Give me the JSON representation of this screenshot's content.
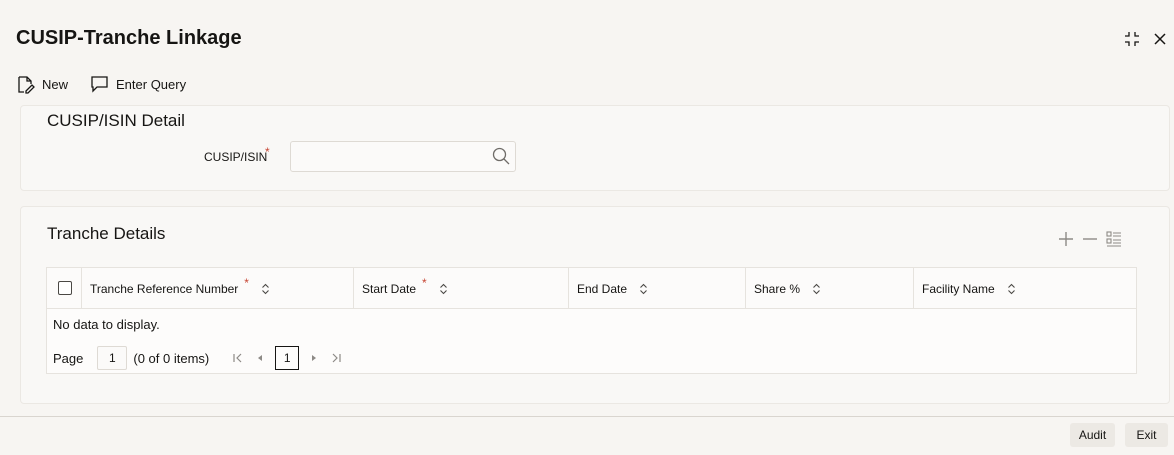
{
  "header": {
    "title": "CUSIP-Tranche Linkage"
  },
  "toolbar": {
    "new_label": "New",
    "enter_query_label": "Enter Query"
  },
  "cusip_section": {
    "title": "CUSIP/ISIN Detail",
    "field_label": "CUSIP/ISIN",
    "required_mark": "*",
    "value": "",
    "placeholder": ""
  },
  "tranche_section": {
    "title": "Tranche Details",
    "columns": [
      {
        "label": "Tranche Reference Number",
        "required": "*"
      },
      {
        "label": "Start Date",
        "required": "*"
      },
      {
        "label": "End Date",
        "required": ""
      },
      {
        "label": "Share %",
        "required": ""
      },
      {
        "label": "Facility Name",
        "required": ""
      }
    ],
    "empty_text": "No data to display.",
    "pager": {
      "label": "Page",
      "page_value": "1",
      "items_text": "(0 of 0 items)",
      "current_page": "1"
    }
  },
  "footer": {
    "audit_label": "Audit",
    "exit_label": "Exit"
  },
  "colors": {
    "required": "#c74634",
    "background": "#f7f5f2"
  }
}
